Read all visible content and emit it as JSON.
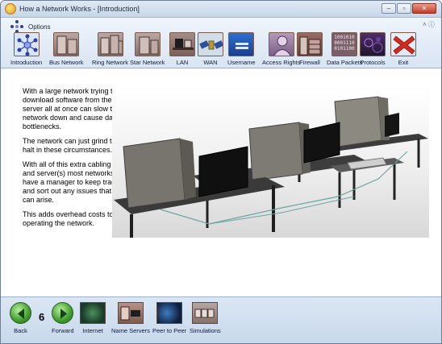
{
  "window": {
    "title": "How a Network Works - [Introduction]"
  },
  "ribbon": {
    "options_label": "Options"
  },
  "toolbar": {
    "items": [
      {
        "label": "Introduction",
        "icon": "network-hub-icon"
      },
      {
        "label": "Bus Network",
        "icon": "server-icon"
      },
      {
        "label": "Ring Network",
        "icon": "server-icon"
      },
      {
        "label": "Star Network",
        "icon": "server-icon"
      },
      {
        "label": "LAN",
        "icon": "computer-desk-icon"
      },
      {
        "label": "WAN",
        "icon": "satellite-icon"
      },
      {
        "label": "Username",
        "icon": "user-login-icon"
      },
      {
        "label": "Access Rights",
        "icon": "person-icon"
      },
      {
        "label": "Firewall",
        "icon": "firewall-icon"
      },
      {
        "label": "Data Packets",
        "icon": "binary-data-icon",
        "binary": [
          "1001010",
          "0001110",
          "0101100"
        ]
      },
      {
        "label": "Protocols",
        "icon": "protocols-icon"
      },
      {
        "label": "Exit",
        "icon": "close-x-icon"
      }
    ]
  },
  "content": {
    "paragraphs": [
      "With a large network trying to download software from the server all at once can slow the network down and cause data bottlenecks.",
      "The network can just grind to a halt in these circumstances.",
      "With all of this extra cabling and server(s) most networks have a manager to keep track and sort out any issues that can arise.",
      "This adds overhead costs to operating the network."
    ]
  },
  "bottom": {
    "back_label": "Back",
    "forward_label": "Forward",
    "page_number": "6",
    "items": [
      {
        "label": "Internet",
        "icon": "globe-icon"
      },
      {
        "label": "Name Servers",
        "icon": "name-server-icon"
      },
      {
        "label": "Peer to Peer",
        "icon": "peer-to-peer-icon"
      },
      {
        "label": "Simulations",
        "icon": "simulation-icon"
      }
    ]
  },
  "colors": {
    "ribbon": "#d9e5f3",
    "exit_red": "#d42a1e",
    "nav_green": "#3f9c2a"
  }
}
